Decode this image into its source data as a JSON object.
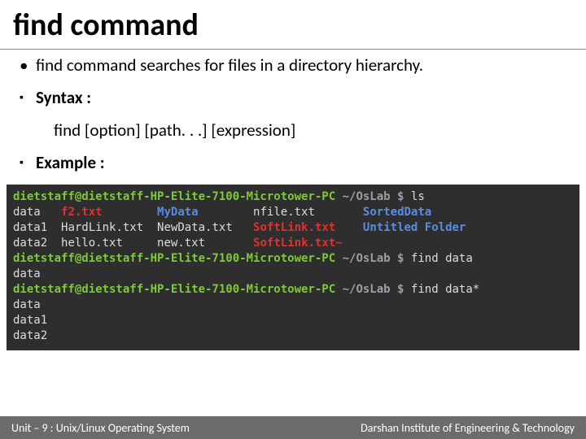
{
  "title": {
    "bold": "find",
    "rest": " command"
  },
  "bullets": {
    "intro": "find command searches for files in a directory hierarchy.",
    "syntax_label": "Syntax :",
    "syntax_text": "find [option] [path. . .] [expression]",
    "example_label": "Example :"
  },
  "terminal": {
    "prompt_user": "dietstaff@dietstaff-HP-Elite-7100-Microtower-PC",
    "prompt_path": "~/OsLab",
    "dollar": "$",
    "cmd_ls": "ls",
    "cmd_find_data": "find data",
    "cmd_find_data_glob": "find data*",
    "ls_row1": {
      "c1": "data",
      "c2": "f2.txt",
      "c3": "MyData",
      "c4": "nfile.txt",
      "c5": "SortedData"
    },
    "ls_row2": {
      "c1": "data1",
      "c2": "HardLink.txt",
      "c3": "NewData.txt",
      "c4": "SoftLink.txt",
      "c5": "Untitled Folder"
    },
    "ls_row3": {
      "c1": "data2",
      "c2": "hello.txt",
      "c3": "new.txt",
      "c4": "SoftLink.txt~",
      "c5": ""
    },
    "out1": "data",
    "out2a": "data",
    "out2b": "data1",
    "out2c": "data2"
  },
  "footer": {
    "left": "Unit – 9 : Unix/Linux Operating System",
    "right": "Darshan Institute of Engineering & Technology"
  }
}
